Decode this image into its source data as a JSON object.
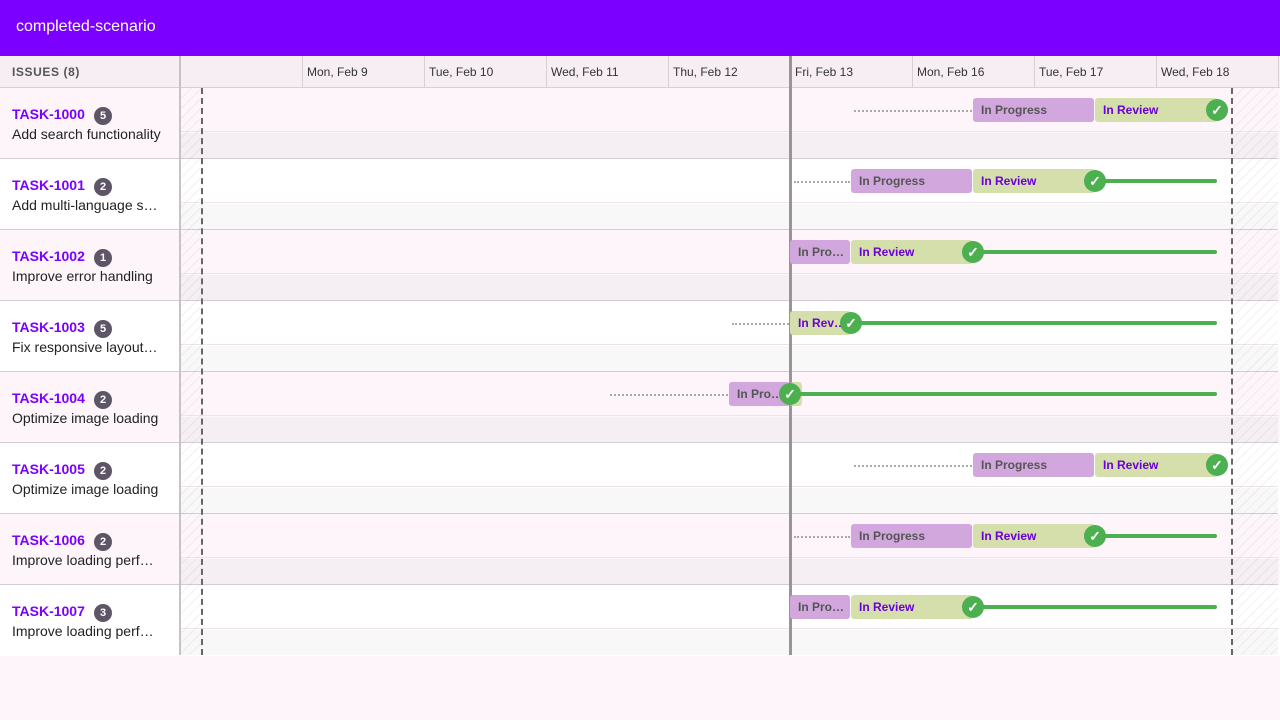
{
  "app": {
    "title": "completed-scenario"
  },
  "issues_header": "ISSUES (8)",
  "dates": [
    "Mon, Feb 9",
    "Tue, Feb 10",
    "Wed, Feb 11",
    "Thu, Feb 12",
    "Fri, Feb 13",
    "Mon, Feb 16",
    "Tue, Feb 17",
    "Wed, Feb 18"
  ],
  "issues": [
    {
      "key": "TASK-1000",
      "count": "5",
      "summary": "Add search functionality",
      "progress_label": "In Progress",
      "review_label": "In Review"
    },
    {
      "key": "TASK-1001",
      "count": "2",
      "summary": "Add multi-language s…",
      "progress_label": "In Progress",
      "review_label": "In Review"
    },
    {
      "key": "TASK-1002",
      "count": "1",
      "summary": "Improve error handling",
      "progress_label": "In Pro…",
      "review_label": "In Review"
    },
    {
      "key": "TASK-1003",
      "count": "5",
      "summary": "Fix responsive layout…",
      "progress_label": "",
      "review_label": "In Rev…"
    },
    {
      "key": "TASK-1004",
      "count": "2",
      "summary": "Optimize image loading",
      "progress_label": "In Pro…",
      "review_label": ""
    },
    {
      "key": "TASK-1005",
      "count": "2",
      "summary": "Optimize image loading",
      "progress_label": "In Progress",
      "review_label": "In Review"
    },
    {
      "key": "TASK-1006",
      "count": "2",
      "summary": "Improve loading perf…",
      "progress_label": "In Progress",
      "review_label": "In Review"
    },
    {
      "key": "TASK-1007",
      "count": "3",
      "summary": "Improve loading perf…",
      "progress_label": "In Pro…",
      "review_label": "In Review"
    }
  ],
  "colors": {
    "brand": "#7b00ff",
    "in_progress": "#d1a7dd",
    "in_review": "#d5dfab",
    "done": "#4caf50"
  },
  "icons": {
    "done": "check-circle-icon"
  }
}
